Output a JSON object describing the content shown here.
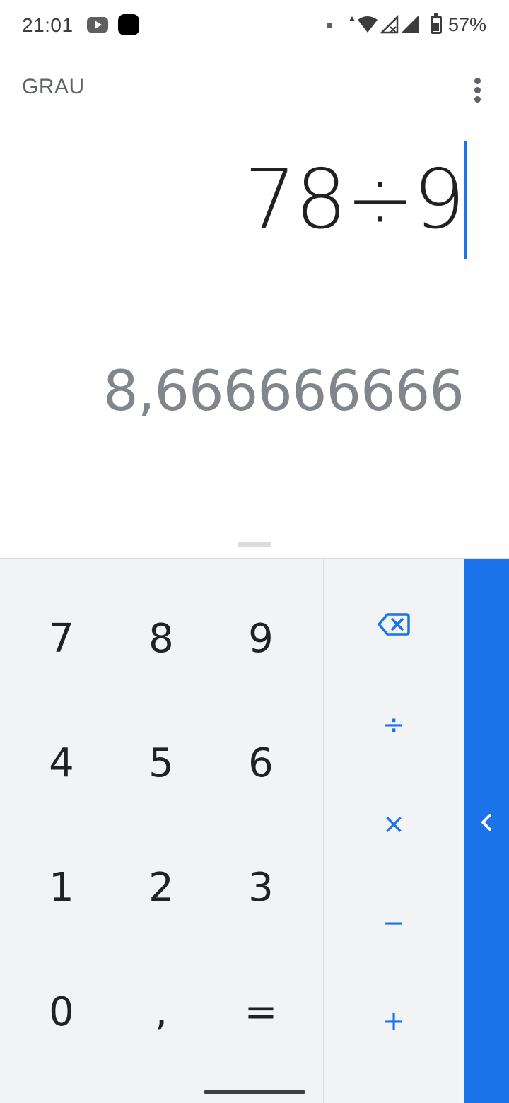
{
  "status_bar": {
    "time": "21:01",
    "battery_percent": "57%",
    "battery_level": 0.57,
    "icons": [
      "youtube-icon",
      "app-notification-icon",
      "dot-icon",
      "wifi-icon",
      "signal-icon",
      "signal-icon",
      "battery-icon"
    ]
  },
  "top_bar": {
    "mode_label": "GRAU",
    "more_icon": "more-vert-icon"
  },
  "display": {
    "formula": "78÷9",
    "result": "8,666666666"
  },
  "keypad": {
    "digits": {
      "seven": "7",
      "eight": "8",
      "nine": "9",
      "four": "4",
      "five": "5",
      "six": "6",
      "one": "1",
      "two": "2",
      "three": "3",
      "zero": "0",
      "decimal": ",",
      "equals": "="
    },
    "operators": {
      "delete_icon": "backspace-icon",
      "divide": "÷",
      "multiply": "×",
      "minus": "−",
      "plus": "+"
    },
    "advanced_toggle_icon": "chevron-left-icon"
  },
  "colors": {
    "accent": "#1a73e8",
    "result_text": "#80868b",
    "keypad_bg": "#f1f3f4"
  }
}
